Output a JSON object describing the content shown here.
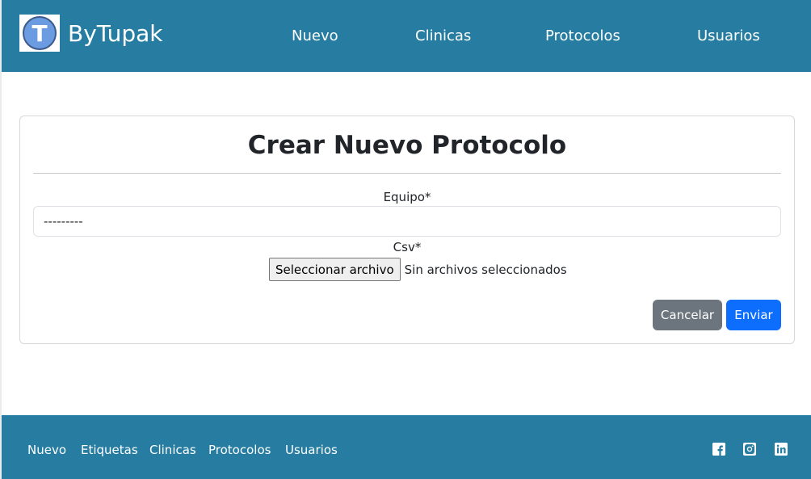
{
  "header": {
    "brand": {
      "logo_letter": "T",
      "name": "ByTupak"
    },
    "nav": [
      "Nuevo",
      "Clinicas",
      "Protocolos",
      "Usuarios"
    ]
  },
  "form": {
    "title": "Crear Nuevo Protocolo",
    "equipo_label": "Equipo*",
    "equipo_selected": "---------",
    "csv_label": "Csv*",
    "file_button": "Seleccionar archivo",
    "file_status": "Sin archivos seleccionados",
    "cancel_label": "Cancelar",
    "submit_label": "Enviar"
  },
  "footer": {
    "links": [
      "Nuevo",
      "Etiquetas",
      "Clinicas",
      "Protocolos",
      "Usuarios"
    ],
    "social_icons": [
      "facebook-icon",
      "instagram-icon",
      "linkedin-icon"
    ]
  },
  "colors": {
    "header_bg": "#267da1",
    "cancel_bg": "#6c757d",
    "submit_bg": "#0d6efd"
  }
}
